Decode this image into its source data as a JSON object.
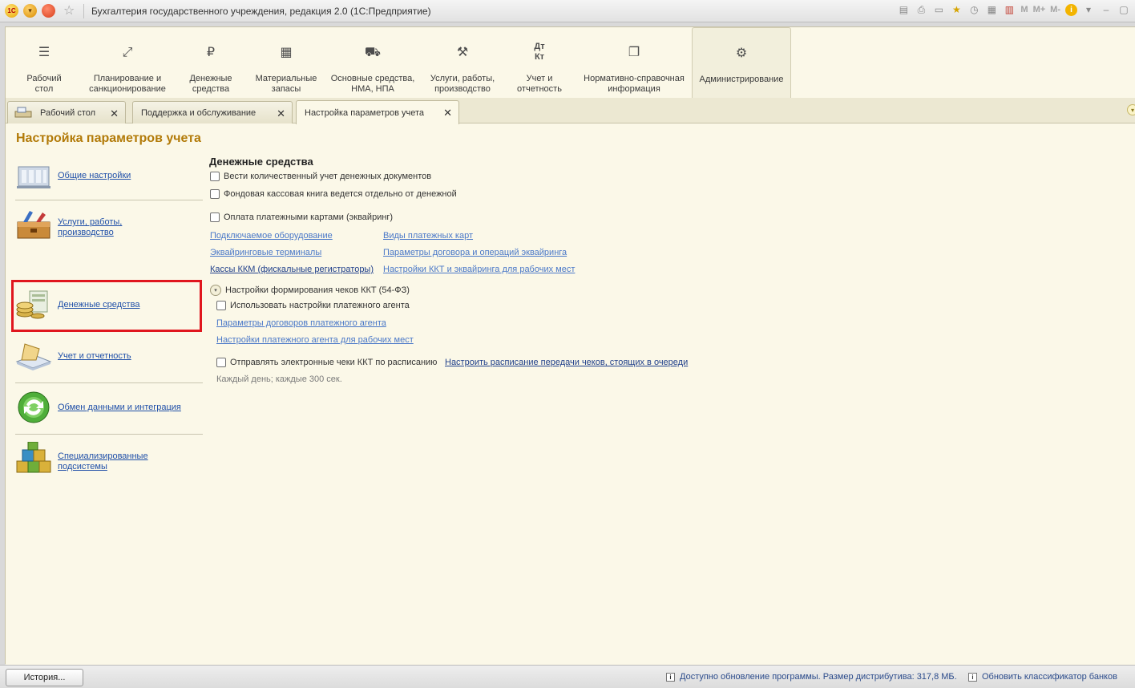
{
  "window": {
    "title": "Бухгалтерия государственного учреждения, редакция 2.0  (1С:Предприятие)",
    "logo_text": "1С",
    "memory_buttons": [
      "M",
      "M+",
      "M-"
    ]
  },
  "ribbon": {
    "items": [
      {
        "label": "Рабочий\nстол",
        "icon": "menu-lines-icon"
      },
      {
        "label": "Планирование и\nсанкционирование",
        "icon": "axes-icon"
      },
      {
        "label": "Денежные\nсредства",
        "icon": "ruble-icon"
      },
      {
        "label": "Материальные\nзапасы",
        "icon": "grid-icon"
      },
      {
        "label": "Основные средства,\nНМА, НПА",
        "icon": "truck-icon"
      },
      {
        "label": "Услуги, работы,\nпроизводство",
        "icon": "tools-icon"
      },
      {
        "label": "Учет и\nотчетность",
        "icon": "debit-credit-icon"
      },
      {
        "label": "Нормативно-справочная\nинформация",
        "icon": "documents-icon"
      },
      {
        "label": "Администрирование",
        "icon": "gear-icon"
      }
    ],
    "active_index": 8
  },
  "tabs": [
    {
      "label": "Рабочий стол",
      "close": "✕"
    },
    {
      "label": "Поддержка и обслуживание",
      "close": "✕"
    },
    {
      "label": "Настройка параметров учета",
      "close": "✕"
    }
  ],
  "page": {
    "title": "Настройка параметров учета"
  },
  "sidebar": {
    "items": [
      {
        "label": "Общие настройки",
        "icon": "building-icon"
      },
      {
        "label": "Услуги, работы,\nпроизводство",
        "icon": "toolbox-icon"
      },
      {
        "label": "Денежные средства",
        "icon": "coins-icon"
      },
      {
        "label": "Учет и отчетность",
        "icon": "ledger-icon"
      },
      {
        "label": "Обмен данными и интеграция",
        "icon": "sync-icon"
      },
      {
        "label": "Специализированные\nподсистемы",
        "icon": "cubes-icon"
      }
    ],
    "selected_index": 2
  },
  "main": {
    "section_title": "Денежные средства",
    "check_quantity": "Вести количественный учет денежных документов",
    "check_fund_cashbook": "Фондовая кассовая книга ведется отдельно от денежной",
    "check_card_payment": "Оплата платежными картами (эквайринг)",
    "link_equipment": "Подключаемое оборудование",
    "link_card_types": "Виды платежных карт",
    "link_terminals": "Эквайринговые терминалы",
    "link_contract_params": "Параметры договора и операций эквайринга",
    "link_kkm": "Кассы ККМ (фискальные регистраторы)",
    "link_kkt_settings": "Настройки ККТ и эквайринга для рабочих мест",
    "group_receipts": "Настройки формирования чеков ККТ (54-ФЗ)",
    "check_agent": "Использовать настройки платежного агента",
    "link_agent_contracts": "Параметры договоров платежного агента",
    "link_agent_workplaces": "Настройки платежного агента для рабочих мест",
    "check_send_schedule": "Отправлять электронные чеки ККТ по расписанию",
    "link_schedule": "Настроить расписание передачи чеков, стоящих в очереди",
    "schedule_note": "Каждый  день; каждые 300 сек."
  },
  "statusbar": {
    "history_label": "История...",
    "update_msg": "Доступно обновление программы. Размер дистрибутива: 317,8 МБ.",
    "classifier_msg": "Обновить классификатор банков"
  },
  "colors": {
    "accent_title": "#b27a08",
    "link": "#1f4fa8",
    "highlight": "#e0161e",
    "background": "#fbf8e8"
  }
}
